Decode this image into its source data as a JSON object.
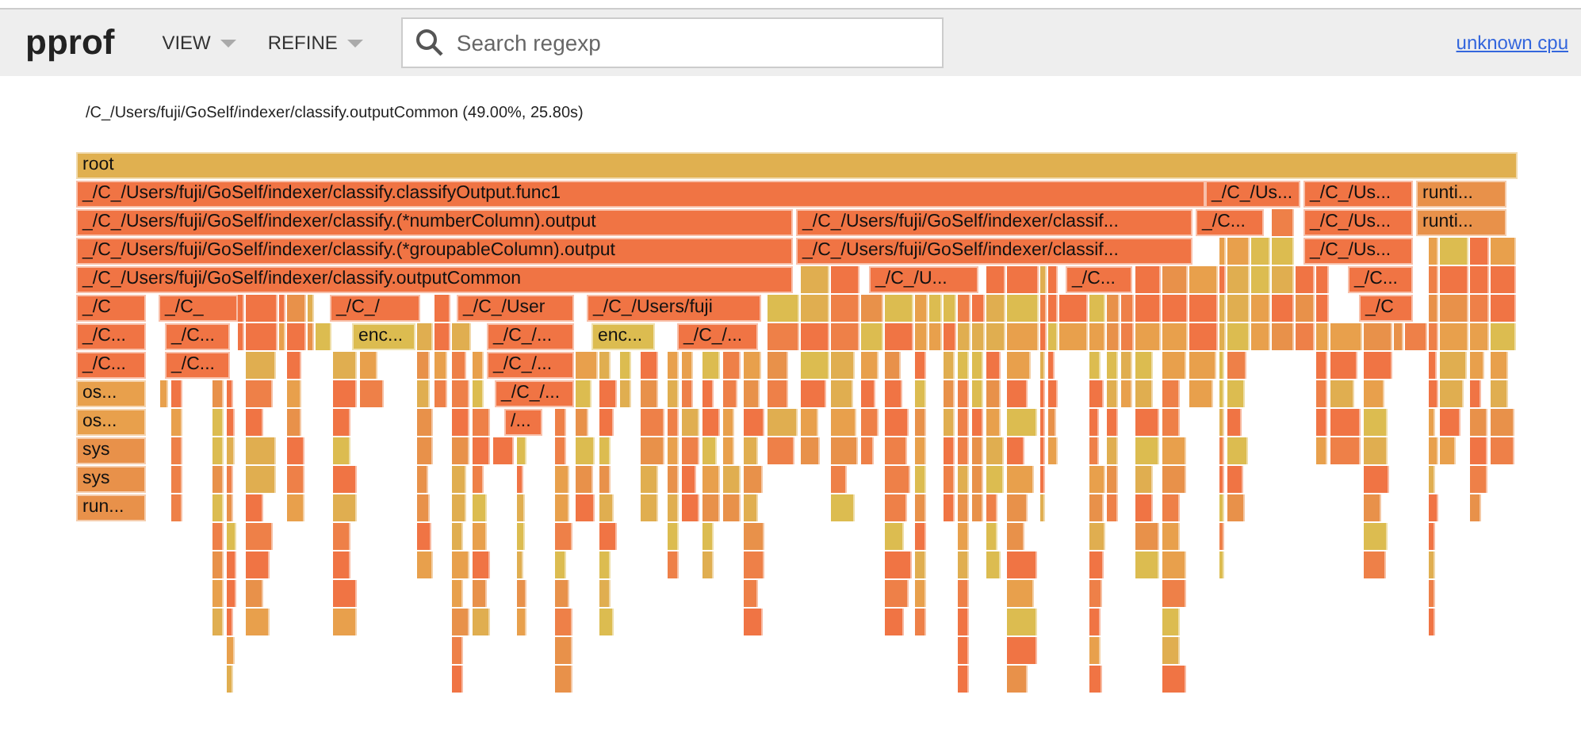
{
  "header": {
    "logo": "pprof",
    "menus": [
      {
        "label": "VIEW"
      },
      {
        "label": "REFINE"
      }
    ],
    "search": {
      "placeholder": "Search regexp"
    },
    "profile_link": "unknown cpu"
  },
  "details": "/C_/Users/fuji/GoSelf/indexer/classify.outputCommon (49.00%, 25.80s)",
  "flame_rows": [
    [
      {
        "label": "root",
        "color": "#e0b050"
      }
    ],
    [
      {
        "label": "_/C_/Users/fuji/GoSelf/indexer/classify.classifyOutput.func1",
        "color": "#f07444"
      },
      {
        "label": "_/C_/Us...",
        "color": "#f07444"
      },
      {
        "label": "_/C_/Us...",
        "color": "#f07444"
      },
      {
        "label": "runti...",
        "color": "#e8914a"
      }
    ],
    [
      {
        "label": "_/C_/Users/fuji/GoSelf/indexer/classify.(*numberColumn).output",
        "color": "#f07444"
      },
      {
        "label": "_/C_/Users/fuji/GoSelf/indexer/classif...",
        "color": "#f07444"
      },
      {
        "label": "_/C...",
        "color": "#f07444"
      },
      {
        "label": "_/C_/Us...",
        "color": "#f07444"
      },
      {
        "label": "runti...",
        "color": "#e8914a"
      }
    ],
    [
      {
        "label": "_/C_/Users/fuji/GoSelf/indexer/classify.(*groupableColumn).output",
        "color": "#f07444"
      },
      {
        "label": "_/C_/Users/fuji/GoSelf/indexer/classif...",
        "color": "#f07444"
      },
      {
        "label": "_/C_/Us...",
        "color": "#f07444"
      }
    ],
    [
      {
        "label": "_/C_/Users/fuji/GoSelf/indexer/classify.outputCommon",
        "color": "#f07444"
      },
      {
        "label": "_/C_/U...",
        "color": "#f07444"
      },
      {
        "label": "_/C...",
        "color": "#f07444"
      },
      {
        "label": "_/C...",
        "color": "#f07444"
      }
    ],
    [
      {
        "label": "_/C",
        "color": "#f07444"
      },
      {
        "label": "_/C_",
        "color": "#f07444"
      },
      {
        "label": "_/C_/",
        "color": "#f07444"
      },
      {
        "label": "_/C_/User",
        "color": "#f07444"
      },
      {
        "label": "_/C_/Users/fuji",
        "color": "#f07444"
      },
      {
        "label": "_/C",
        "color": "#f07444"
      }
    ],
    [
      {
        "label": "_/C...",
        "color": "#f07444"
      },
      {
        "label": "_/C...",
        "color": "#f07444"
      },
      {
        "label": "enc...",
        "color": "#dcbc50"
      },
      {
        "label": "_/C_/...",
        "color": "#f07444"
      },
      {
        "label": "enc...",
        "color": "#dcbc50"
      },
      {
        "label": "_/C_/...",
        "color": "#f07444"
      }
    ],
    [
      {
        "label": "_/C...",
        "color": "#f07444"
      },
      {
        "label": "_/C...",
        "color": "#f07444"
      },
      {
        "label": "_/C_/...",
        "color": "#f07444"
      }
    ],
    [
      {
        "label": "os...",
        "color": "#e8a04c"
      },
      {
        "label": "_/C_/...",
        "color": "#f07444"
      }
    ],
    [
      {
        "label": "os...",
        "color": "#e8a04c"
      },
      {
        "label": "/...",
        "color": "#f07444"
      }
    ],
    [
      {
        "label": "sys",
        "color": "#e8914a"
      }
    ],
    [
      {
        "label": "sys",
        "color": "#e8914a"
      }
    ],
    [
      {
        "label": "run...",
        "color": "#e8914a"
      }
    ]
  ]
}
